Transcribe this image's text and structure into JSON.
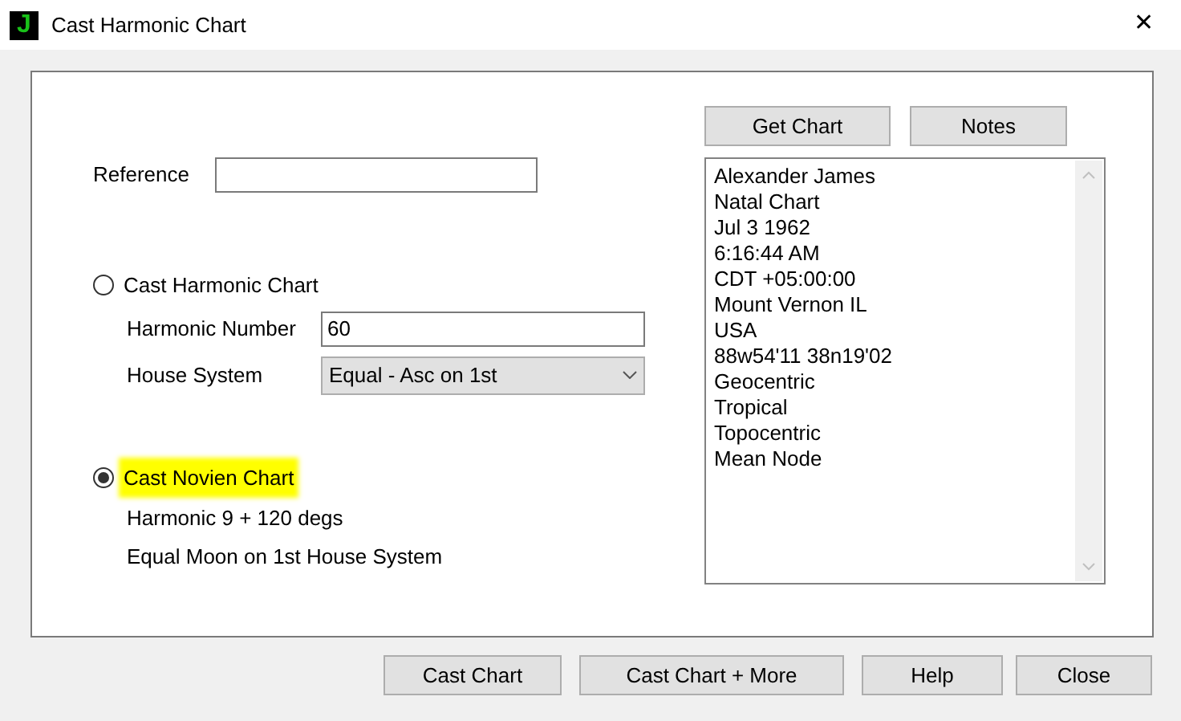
{
  "window": {
    "app_icon": "J",
    "title": "Cast Harmonic Chart",
    "close": "✕"
  },
  "reference": {
    "label": "Reference"
  },
  "options": [
    {
      "label": "Cast Harmonic Chart",
      "selected": false,
      "highlighted": false,
      "fields": [
        {
          "kind": "text",
          "label": "Harmonic Number",
          "value": "60"
        },
        {
          "kind": "select",
          "label": "House System",
          "value": "Equal - Asc on 1st"
        }
      ]
    },
    {
      "label": "Cast Novien Chart",
      "selected": true,
      "highlighted": true,
      "notes": [
        "Harmonic 9 + 120 degs",
        "Equal Moon on 1st House System"
      ]
    }
  ],
  "chart_buttons": [
    "Get Chart",
    "Notes"
  ],
  "chart_info": [
    "Alexander James",
    "Natal Chart",
    "Jul 3 1962",
    "6:16:44 AM",
    "CDT +05:00:00",
    "Mount Vernon IL",
    "USA",
    "88w54'11 38n19'02",
    "Geocentric",
    "Tropical",
    "Topocentric",
    "Mean Node"
  ],
  "buttons": [
    "Cast Chart",
    "Cast Chart + More",
    "Help",
    "Close"
  ]
}
